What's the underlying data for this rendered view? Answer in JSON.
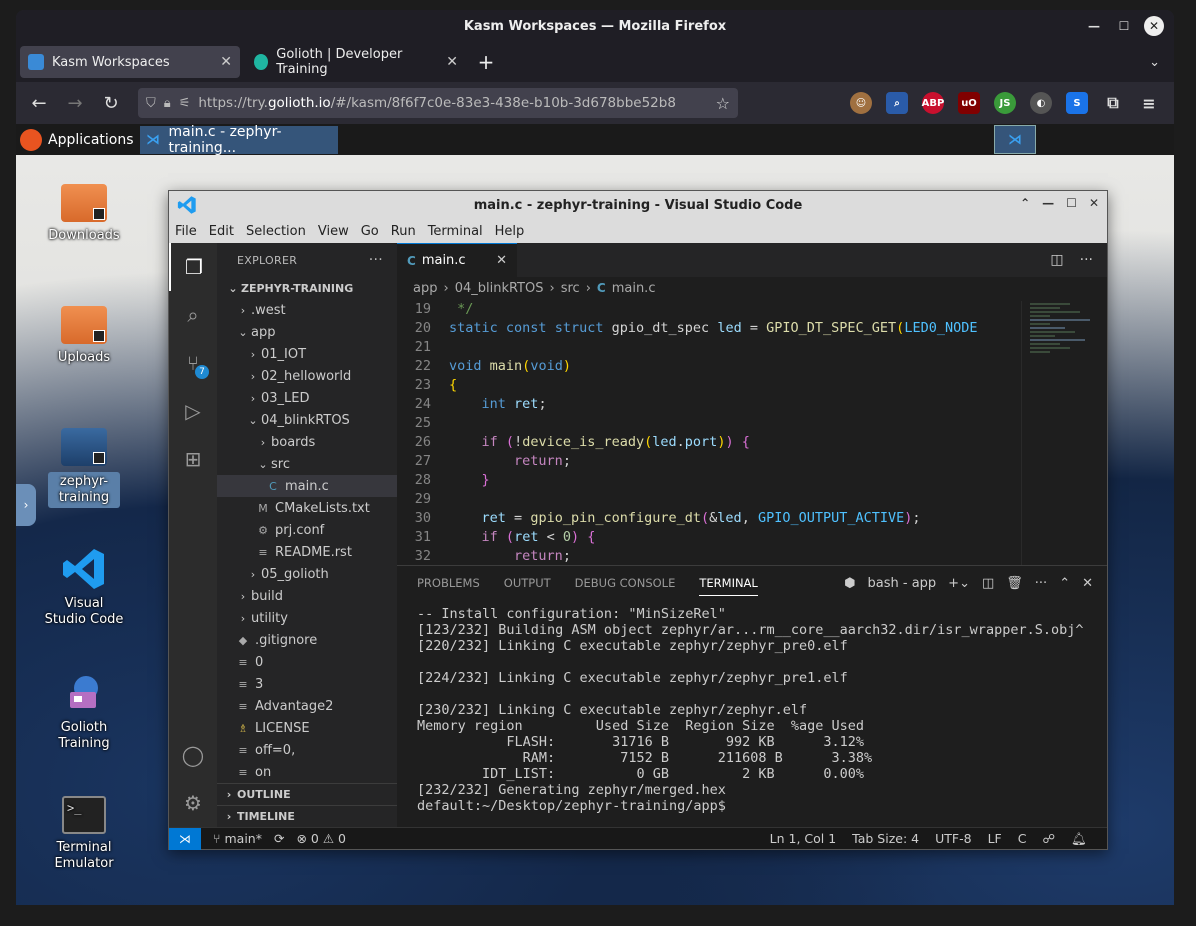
{
  "browser": {
    "window_title": "Kasm Workspaces — Mozilla Firefox",
    "tabs": [
      {
        "label": "Kasm Workspaces"
      },
      {
        "label": "Golioth | Developer Training"
      }
    ],
    "url_prefix": "https://try.",
    "url_domain": "golioth.io",
    "url_rest": "/#/kasm/8f6f7c0e-83e3-438e-b10b-3d678bbe52b8",
    "extensions": [
      "ABP",
      "uO",
      "JS"
    ]
  },
  "panel": {
    "apps_label": "Applications",
    "task_label": "main.c - zephyr-training..."
  },
  "desktop": {
    "icons": [
      "Downloads",
      "Uploads",
      "zephyr-training",
      "Visual Studio Code",
      "Golioth Training",
      "Terminal Emulator"
    ]
  },
  "vscode": {
    "title": "main.c - zephyr-training - Visual Studio Code",
    "menu": [
      "File",
      "Edit",
      "Selection",
      "View",
      "Go",
      "Run",
      "Terminal",
      "Help"
    ],
    "explorer_title": "EXPLORER",
    "scm_badge": "7",
    "tree": [
      {
        "label": "ZEPHYR-TRAINING",
        "chev": "⌄",
        "depth": 0,
        "bold": true
      },
      {
        "label": ".west",
        "chev": "›",
        "depth": 1
      },
      {
        "label": "app",
        "chev": "⌄",
        "depth": 1
      },
      {
        "label": "01_IOT",
        "chev": "›",
        "depth": 2
      },
      {
        "label": "02_helloworld",
        "chev": "›",
        "depth": 2
      },
      {
        "label": "03_LED",
        "chev": "›",
        "depth": 2
      },
      {
        "label": "04_blinkRTOS",
        "chev": "⌄",
        "depth": 2
      },
      {
        "label": "boards",
        "chev": "›",
        "depth": 3
      },
      {
        "label": "src",
        "chev": "⌄",
        "depth": 3
      },
      {
        "label": "main.c",
        "icon": "C",
        "depth": 4,
        "selected": true
      },
      {
        "label": "CMakeLists.txt",
        "icon": "M",
        "depth": 3
      },
      {
        "label": "prj.conf",
        "icon": "⚙",
        "depth": 3
      },
      {
        "label": "README.rst",
        "icon": "≡",
        "depth": 3
      },
      {
        "label": "05_golioth",
        "chev": "›",
        "depth": 2
      },
      {
        "label": "build",
        "chev": "›",
        "depth": 1
      },
      {
        "label": "utility",
        "chev": "›",
        "depth": 1
      },
      {
        "label": ".gitignore",
        "icon": "◆",
        "depth": 1
      },
      {
        "label": "0",
        "icon": "≡",
        "depth": 1
      },
      {
        "label": "3",
        "icon": "≡",
        "depth": 1
      },
      {
        "label": "Advantage2",
        "icon": "≡",
        "depth": 1
      },
      {
        "label": "LICENSE",
        "icon": "♗",
        "depth": 1
      },
      {
        "label": "off=0,",
        "icon": "≡",
        "depth": 1
      },
      {
        "label": "on",
        "icon": "≡",
        "depth": 1
      }
    ],
    "outline_label": "OUTLINE",
    "timeline_label": "TIMELINE",
    "editor_tab": "main.c",
    "breadcrumb": [
      "app",
      "04_blinkRTOS",
      "src",
      "main.c"
    ],
    "code_lines": [
      {
        "n": "19",
        "html": "<span class=\"cmt\"> */</span>"
      },
      {
        "n": "20",
        "html": "<span class=\"kw\">static</span> <span class=\"kw\">const</span> <span class=\"kw\">struct</span> <span class=\"txt\">gpio_dt_spec</span> <span class=\"var\">led</span> <span class=\"txt\">=</span> <span class=\"fn\">GPIO_DT_SPEC_GET</span><span class=\"br1\">(</span><span class=\"mac\">LED0_NODE</span>"
      },
      {
        "n": "21",
        "html": ""
      },
      {
        "n": "22",
        "html": "<span class=\"kw\">void</span> <span class=\"fn\">main</span><span class=\"br1\">(</span><span class=\"kw\">void</span><span class=\"br1\">)</span>"
      },
      {
        "n": "23",
        "html": "<span class=\"br1\">{</span>"
      },
      {
        "n": "24",
        "html": "    <span class=\"kw\">int</span> <span class=\"var\">ret</span><span class=\"txt\">;</span>"
      },
      {
        "n": "25",
        "html": ""
      },
      {
        "n": "26",
        "html": "    <span class=\"ctl-kw\">if</span> <span class=\"br2\">(</span><span class=\"txt\">!</span><span class=\"fn\">device_is_ready</span><span class=\"br1\">(</span><span class=\"var\">led</span><span class=\"txt\">.</span><span class=\"var\">port</span><span class=\"br1\">)</span><span class=\"br2\">)</span> <span class=\"br2\">{</span>"
      },
      {
        "n": "27",
        "html": "        <span class=\"ctl-kw\">return</span><span class=\"txt\">;</span>"
      },
      {
        "n": "28",
        "html": "    <span class=\"br2\">}</span>"
      },
      {
        "n": "29",
        "html": ""
      },
      {
        "n": "30",
        "html": "    <span class=\"var\">ret</span> <span class=\"txt\">=</span> <span class=\"fn\">gpio_pin_configure_dt</span><span class=\"br2\">(</span><span class=\"txt\">&amp;</span><span class=\"var\">led</span><span class=\"txt\">,</span> <span class=\"mac\">GPIO_OUTPUT_ACTIVE</span><span class=\"br2\">)</span><span class=\"txt\">;</span>"
      },
      {
        "n": "31",
        "html": "    <span class=\"ctl-kw\">if</span> <span class=\"br2\">(</span><span class=\"var\">ret</span> <span class=\"txt\">&lt;</span> <span class=\"num\">0</span><span class=\"br2\">)</span> <span class=\"br2\">{</span>"
      },
      {
        "n": "32",
        "html": "        <span class=\"ctl-kw\">return</span><span class=\"txt\">;</span>"
      }
    ],
    "panel_tabs": [
      "PROBLEMS",
      "OUTPUT",
      "DEBUG CONSOLE",
      "TERMINAL"
    ],
    "terminal_name": "bash - app",
    "terminal_lines": [
      "-- Install configuration: \"MinSizeRel\"",
      "[123/232] Building ASM object zephyr/ar...rm__core__aarch32.dir/isr_wrapper.S.obj^",
      "[220/232] Linking C executable zephyr/zephyr_pre0.elf",
      "",
      "[224/232] Linking C executable zephyr/zephyr_pre1.elf",
      "",
      "[230/232] Linking C executable zephyr/zephyr.elf",
      "Memory region         Used Size  Region Size  %age Used",
      "           FLASH:       31716 B       992 KB      3.12%",
      "             RAM:        7152 B      211608 B      3.38%",
      "        IDT_LIST:          0 GB         2 KB      0.00%",
      "[232/232] Generating zephyr/merged.hex",
      "default:~/Desktop/zephyr-training/app$"
    ],
    "status": {
      "branch": "main*",
      "errors": "0",
      "warnings": "0",
      "position": "Ln 1, Col 1",
      "tab_size": "Tab Size: 4",
      "encoding": "UTF-8",
      "eol": "LF",
      "language": "C"
    }
  }
}
